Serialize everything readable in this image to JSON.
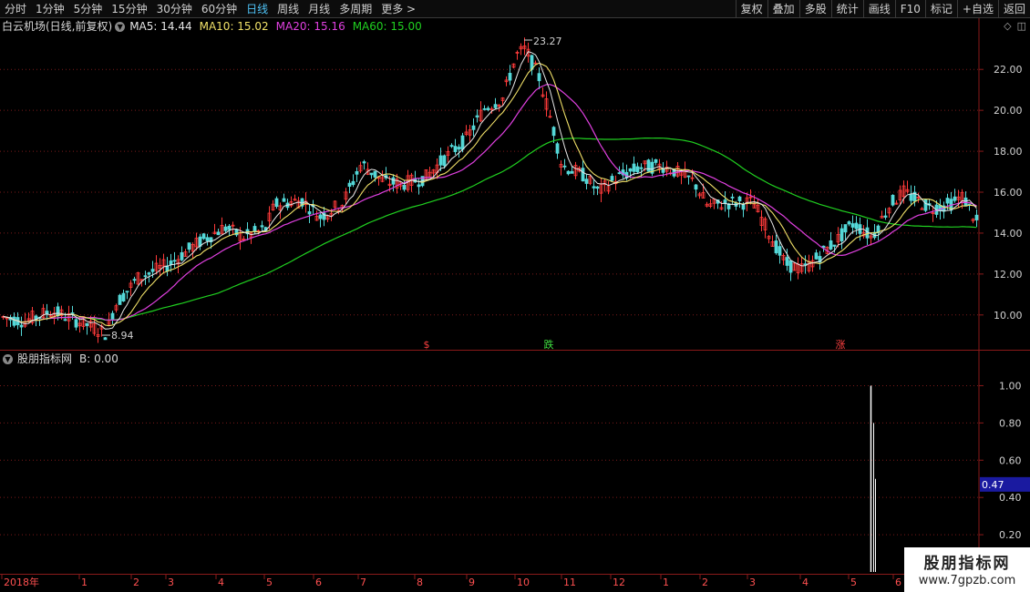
{
  "periods": [
    "分时",
    "1分钟",
    "5分钟",
    "15分钟",
    "30分钟",
    "60分钟",
    "日线",
    "周线",
    "月线",
    "多周期",
    "更多 >"
  ],
  "active_period": "日线",
  "tools": [
    "复权",
    "叠加",
    "多股",
    "统计",
    "画线",
    "F10",
    "标记",
    "+自选",
    "返回"
  ],
  "stock": {
    "title": "白云机场(日线,前复权)"
  },
  "ma": [
    {
      "label": "MA5: 14.44",
      "color": "#e6e6e6"
    },
    {
      "label": "MA10: 15.02",
      "color": "#f0e068"
    },
    {
      "label": "MA20: 15.16",
      "color": "#e040e0"
    },
    {
      "label": "MA60: 15.00",
      "color": "#20d020"
    }
  ],
  "indicator": {
    "title": "股朋指标网",
    "value_label": "B: 0.00"
  },
  "colors": {
    "up": "#ff3a3a",
    "down": "#54d8d8",
    "ma5": "#e6e6e6",
    "ma10": "#f0e068",
    "ma20": "#e040e0",
    "ma60": "#20d020",
    "grid": "#7a1a1a",
    "axis": "#8a1a1a"
  },
  "price_axis": {
    "ticks": [
      "22.00",
      "20.00",
      "18.00",
      "16.00",
      "14.00",
      "12.00",
      "10.00"
    ],
    "values": [
      22,
      20,
      18,
      16,
      14,
      12,
      10
    ],
    "min": 8.3,
    "max": 23.7
  },
  "ind_axis": {
    "ticks": [
      "1.00",
      "0.80",
      "0.60",
      "0.40",
      "0.20"
    ],
    "values": [
      1.0,
      0.8,
      0.6,
      0.4,
      0.2
    ],
    "max": 1.1,
    "cursor_label": "0.47",
    "cursor_value": 0.47
  },
  "annotations": {
    "high": "23.27",
    "low": "8.94",
    "markers": [
      {
        "text": "$",
        "color": "#ff4040"
      },
      {
        "text": "跌",
        "color": "#40e040"
      },
      {
        "text": "涨",
        "color": "#ff4040"
      }
    ]
  },
  "date_axis": [
    "2018年",
    "1",
    "2",
    "3",
    "4",
    "5",
    "6",
    "7",
    "8",
    "9",
    "10",
    "11",
    "12",
    "1",
    "2",
    "3",
    "4",
    "5",
    "6"
  ],
  "watermark": {
    "name": "股朋指标网",
    "url": "www.7gpzb.com"
  }
}
